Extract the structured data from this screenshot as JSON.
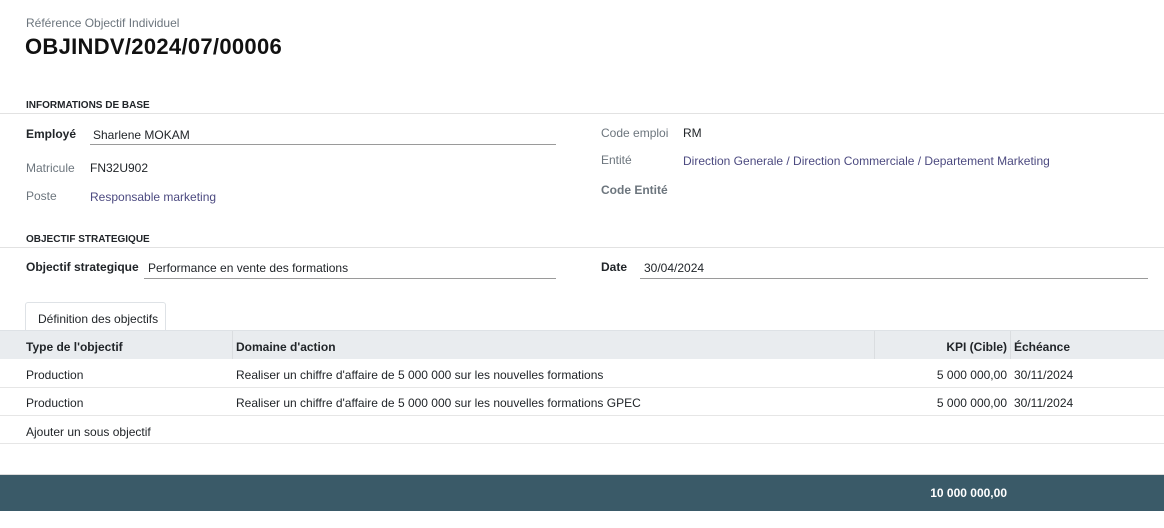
{
  "header": {
    "ref_label": "Référence Objectif Individuel",
    "ref_value": "OBJINDV/2024/07/00006"
  },
  "base_info": {
    "section_title": "INFORMATIONS DE BASE",
    "employe_label": "Employé",
    "employe_value": "Sharlene MOKAM",
    "matricule_label": "Matricule",
    "matricule_value": "FN32U902",
    "poste_label": "Poste",
    "poste_value": "Responsable marketing",
    "code_emploi_label": "Code emploi",
    "code_emploi_value": "RM",
    "entite_label": "Entité",
    "entite_value": "Direction Generale / Direction Commerciale / Departement Marketing",
    "code_entite_label": "Code Entité",
    "code_entite_value": ""
  },
  "strategic": {
    "section_title": "OBJECTIF STRATEGIQUE",
    "objectif_label": "Objectif strategique",
    "objectif_value": "Performance en vente des formations",
    "date_label": "Date",
    "date_value": "30/04/2024"
  },
  "tabs": [
    {
      "label": "Définition des objectifs",
      "active": true
    }
  ],
  "table": {
    "columns": [
      "Type de l'objectif",
      "Domaine d'action",
      "KPI (Cible)",
      "Échéance"
    ],
    "rows": [
      {
        "type": "Production",
        "domaine": "Realiser un chiffre d'affaire de 5 000 000  sur les nouvelles formations",
        "kpi": "5 000 000,00",
        "echeance": "30/11/2024"
      },
      {
        "type": "Production",
        "domaine": "Realiser un chiffre d'affaire de 5 000 000  sur les nouvelles formations GPEC",
        "kpi": "5 000 000,00",
        "echeance": "30/11/2024"
      }
    ],
    "add_line_label": "Ajouter un sous objectif",
    "total_kpi": "10 000 000,00"
  },
  "colors": {
    "link": "#4c4a80",
    "footer_bg": "#3a5a68",
    "header_bg": "#e9ecef"
  }
}
